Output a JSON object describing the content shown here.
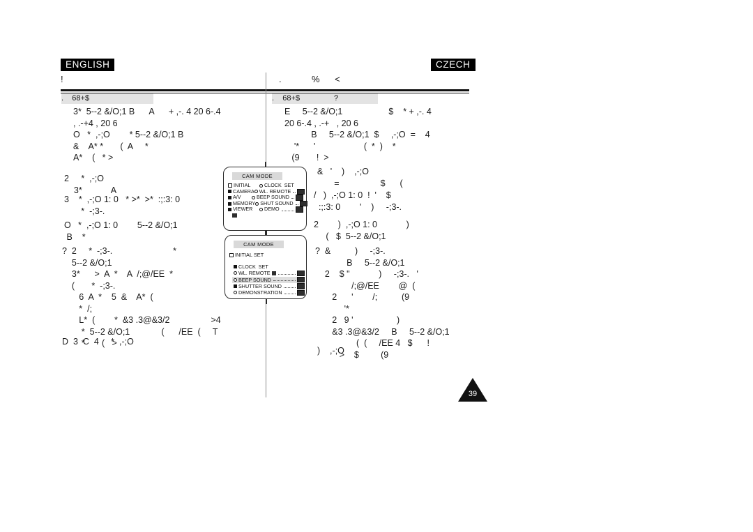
{
  "document": {
    "page_number": "39",
    "languages": {
      "left": "ENGLISH",
      "right": "CZECH"
    },
    "title": {
      "left": "!",
      "right": ".            %      <"
    },
    "section_heading": {
      "left": ".    68+$",
      "right": ".    68+$                ?"
    }
  },
  "left_column": {
    "blocks": [
      "3*  5--2 &/O;1 B      A      + ,-. 4 20 6-.4\n, .-+4 , 20 6\nO   *  ,-;O        * 5--2 &/O;1 B\n&    A* *       (  A     *\nA*    (   * >",
      "2     *  ,-;O\n    3*            A",
      "3    *  ,-;O 1: 0   * >*  >*  :;:3: 0\n       *  -;3-.",
      "O   *  ,-;O 1: 0        5--2 &/O;1\n B    *",
      "?  2     *  -;3-.                         *\n    5--2 &/O;1\n    3*      >  A  *    A  /;@/EE  *\n    (       *  -;3-.\n       6  A  *    5  &    A*  (\n       *  /;\n       L*  (        *  &3 .3@&3/2                 >4\n        *  5--2 &/O;1             (      /EE  (     T\n        *       (   >",
      "D  3  C  4     *  ,-;O"
    ]
  },
  "right_column": {
    "blocks": [
      "E     5--2 &/O;1                   $    * + ,-. 4\n20 6-.4 , .-+   , 20 6\n           B     5--2 &/O;1  $     ,-;O  =    4\n    '*      '                    (  *  )    *\n   (9       !  >",
      "&   '    )    ,-;O\n       =                 $      (",
      "/   )  ,-;O 1: 0  !  '    $\n  :;:3: 0        '    )     -;3-.",
      "2        )  ,-;O 1: 0            )\n     (   $  5--2 &/O;1",
      "?  &          )     -;3-.\n             B     5--2 &/O;1\n    2    $ \"            )     -;3-.   '\n               /;@/EE        @  (\n       2      '        /;          (9\n            '*\n       2   9 '                  )\n       &3 .3@&3/2     B     5--2 &/O;1\n                 (  (     /EE 4   $      !\n          >    $         (9",
      ")    ,-;O"
    ]
  },
  "lcd_screens": [
    {
      "id": "cam-mode-main",
      "title": "CAM MODE",
      "rows": [
        {
          "left_label": "INITIAL",
          "left_marker": "square-hollow",
          "right_label": "CLOCK  SET",
          "right_marker": "ring",
          "dots": false,
          "badge": false
        },
        {
          "left_label": "CAMERA",
          "left_marker": "square",
          "right_label": "WL. REMOTE",
          "right_marker": "ring",
          "dots": true,
          "badge": true
        },
        {
          "left_label": "A/V",
          "left_marker": "square",
          "right_label": "BEEP SOUND",
          "right_marker": "ring",
          "dots": true,
          "badge": true
        },
        {
          "left_label": "MEMORY",
          "left_marker": "square",
          "right_label": "SHUT SOUND",
          "right_marker": "ring",
          "dots": true,
          "badge": true
        },
        {
          "left_label": "VIEWER",
          "left_marker": "square",
          "right_label": "DEMO",
          "right_marker": "ring",
          "dots": true,
          "badge": true
        }
      ]
    },
    {
      "id": "cam-mode-initial-set",
      "title": "CAM MODE",
      "submenu_header": "INITIAL SET",
      "items": [
        {
          "label": "CLOCK  SET",
          "marker": "square",
          "dots": false,
          "badge": false,
          "inline_badge": false,
          "selected": false
        },
        {
          "label": "WL. REMOTE",
          "marker": "ring",
          "dots": true,
          "badge": true,
          "inline_badge": true,
          "selected": false
        },
        {
          "label": "BEEP SOUND",
          "marker": "ring",
          "dots": true,
          "badge": true,
          "inline_badge": false,
          "selected": true
        },
        {
          "label": "SHUTTER SOUND",
          "marker": "square",
          "dots": true,
          "badge": true,
          "inline_badge": false,
          "selected": false
        },
        {
          "label": "DEMONSTRATION",
          "marker": "ring",
          "dots": true,
          "badge": true,
          "inline_badge": false,
          "selected": false
        }
      ]
    }
  ]
}
